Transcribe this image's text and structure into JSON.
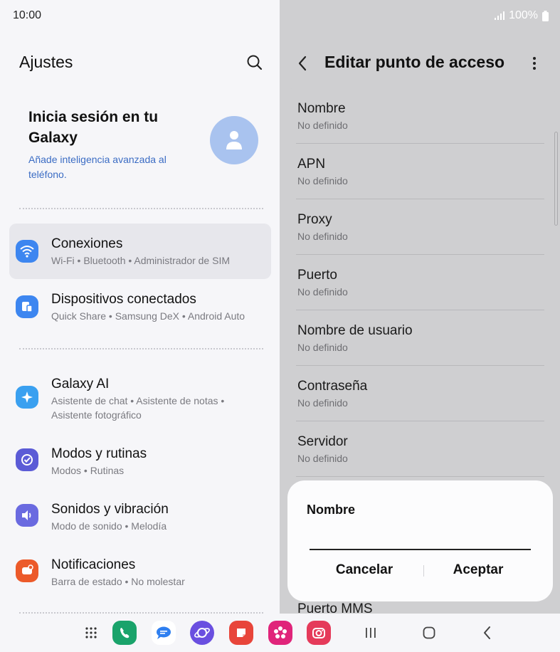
{
  "status": {
    "time": "10:00",
    "battery": "100%"
  },
  "left": {
    "title": "Ajustes",
    "account": {
      "title": "Inicia sesión en tu Galaxy",
      "subtitle": "Añade inteligencia avanzada al teléfono."
    },
    "items": [
      {
        "title": "Conexiones",
        "subtitle": "Wi-Fi • Bluetooth • Administrador de SIM",
        "icon": "wifi-icon",
        "color": "#3d86f0"
      },
      {
        "title": "Dispositivos conectados",
        "subtitle": "Quick Share • Samsung DeX • Android Auto",
        "icon": "devices-icon",
        "color": "#3d86f0"
      },
      {
        "title": "Galaxy AI",
        "subtitle": "Asistente de chat • Asistente de notas • Asistente fotográfico",
        "icon": "sparkle-icon",
        "color": "#3aa0f0"
      },
      {
        "title": "Modos y rutinas",
        "subtitle": "Modos • Rutinas",
        "icon": "check-circle-icon",
        "color": "#5b5bd6"
      },
      {
        "title": "Sonidos y vibración",
        "subtitle": "Modo de sonido • Melodía",
        "icon": "volume-icon",
        "color": "#6a6ae0"
      },
      {
        "title": "Notificaciones",
        "subtitle": "Barra de estado • No molestar",
        "icon": "notification-icon",
        "color": "#ec5a2a"
      }
    ]
  },
  "right": {
    "title": "Editar punto de acceso",
    "rows": [
      {
        "title": "Nombre",
        "value": "No definido"
      },
      {
        "title": "APN",
        "value": "No definido"
      },
      {
        "title": "Proxy",
        "value": "No definido"
      },
      {
        "title": "Puerto",
        "value": "No definido"
      },
      {
        "title": "Nombre de usuario",
        "value": "No definido"
      },
      {
        "title": "Contraseña",
        "value": "No definido"
      },
      {
        "title": "Servidor",
        "value": "No definido"
      },
      {
        "title": "Puerto MMS",
        "value": ""
      }
    ]
  },
  "dialog": {
    "title": "Nombre",
    "input_value": "",
    "cancel": "Cancelar",
    "accept": "Aceptar"
  },
  "dock": [
    {
      "icon": "apps-grid-icon"
    },
    {
      "icon": "phone-icon",
      "color": "#1aa36b"
    },
    {
      "icon": "messages-icon",
      "color": "#2f7ff0"
    },
    {
      "icon": "internet-icon",
      "color": "#6a4fe0"
    },
    {
      "icon": "notes-icon",
      "color": "#e8453a"
    },
    {
      "icon": "flower-icon",
      "color": "#e0247a"
    },
    {
      "icon": "camera-icon",
      "color": "#e53a5a"
    }
  ]
}
